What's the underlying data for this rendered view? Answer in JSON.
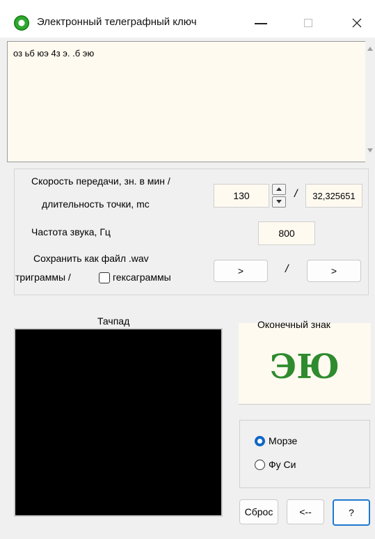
{
  "window": {
    "title": "Электронный телеграфный ключ"
  },
  "text_area": {
    "value": "оз ьб юэ 4з э. .б эю"
  },
  "settings": {
    "speed_label_line1": "Скорость передачи, зн. в мин /",
    "speed_label_line2": "длительность точки, mc",
    "speed_value": "130",
    "slash": "/",
    "dot_duration_value": "32,325651",
    "freq_label": "Частота звука, Гц",
    "freq_value": "800",
    "save_label_line1": "Сохранить как файл .wav",
    "save_label_line2_prefix": "триграммы /",
    "hexagram_label": "гексаграммы",
    "hexagram_checked": false,
    "save_trigram_button": ">",
    "save_hexagram_button": ">"
  },
  "touchpad": {
    "label": "Тачпад"
  },
  "end_sign": {
    "label": "Оконечный знак",
    "value": "ЭЮ",
    "color": "#2e8b2e"
  },
  "mode": {
    "options": [
      {
        "label": "Морзе",
        "selected": true
      },
      {
        "label": "Фу Си",
        "selected": false
      }
    ]
  },
  "buttons": {
    "reset": "Сброс",
    "back": "<--",
    "help": "?"
  }
}
